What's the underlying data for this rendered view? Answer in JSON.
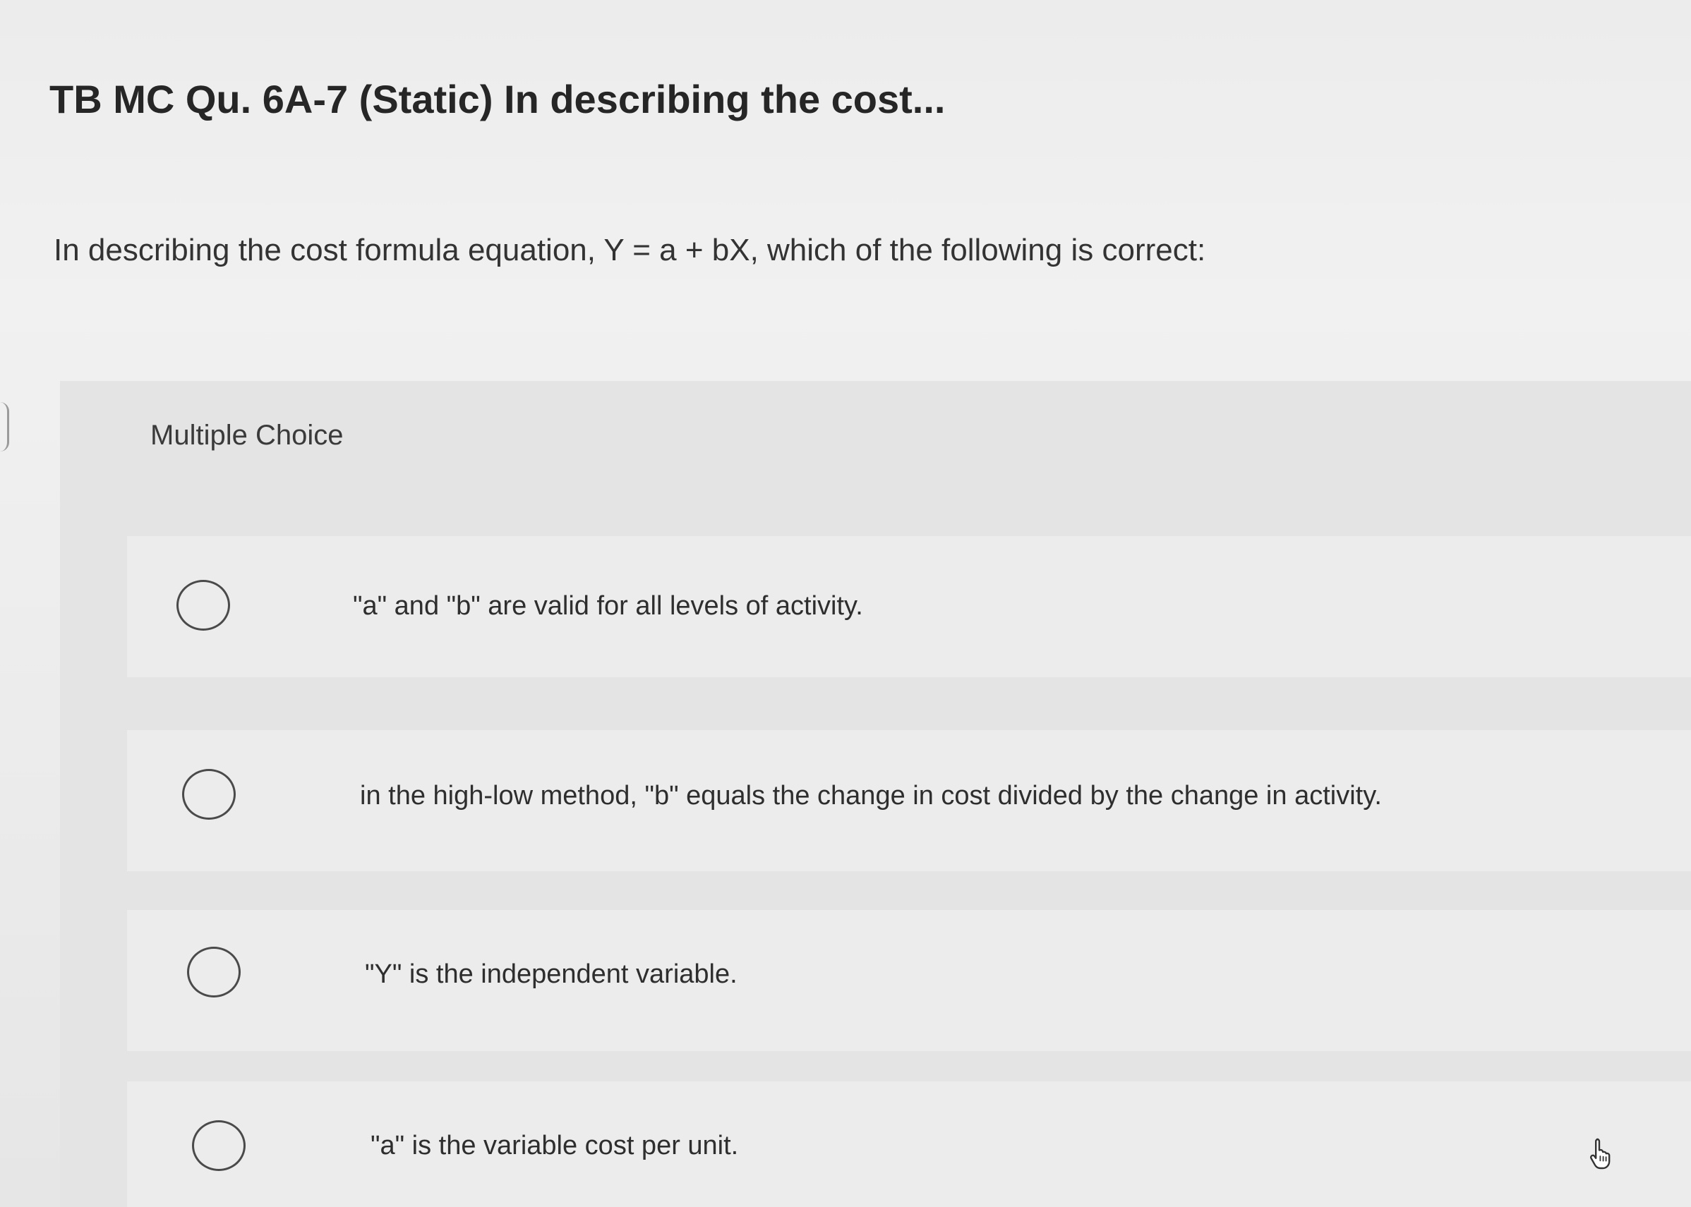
{
  "question": {
    "title": "TB MC Qu. 6A-7 (Static) In describing the cost...",
    "prompt": "In describing the cost formula equation, Y = a + bX, which of the following is correct:"
  },
  "choices_panel": {
    "label": "Multiple Choice",
    "options": [
      {
        "text": "\"a\" and \"b\" are valid for all levels of activity."
      },
      {
        "text": "in the high-low method, \"b\" equals the change in cost divided by the change in activity."
      },
      {
        "text": "\"Y\" is the independent variable."
      },
      {
        "text": "\"a\" is the variable cost per unit."
      }
    ]
  },
  "icons": {
    "radio": "radio-button-unselected-icon",
    "cursor": "hand-pointer-icon"
  }
}
